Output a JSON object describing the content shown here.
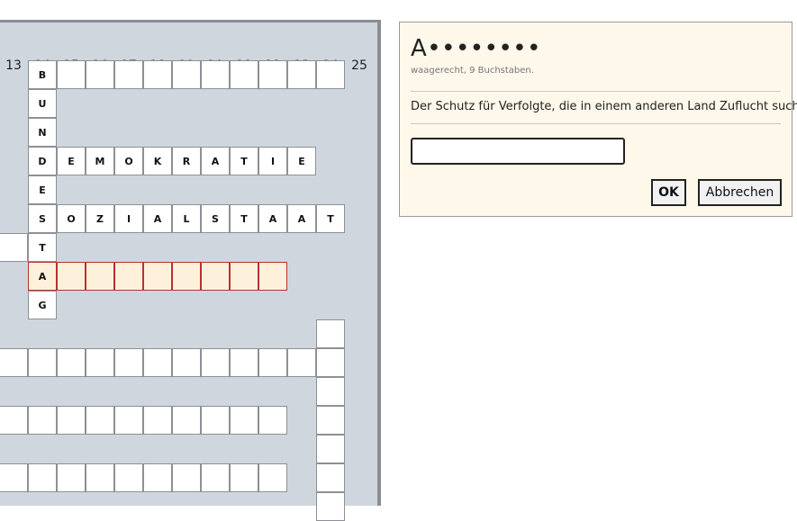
{
  "board": {
    "column_numbers": [
      "13",
      "14",
      "15",
      "16",
      "17",
      "18",
      "19",
      "20",
      "21",
      "22",
      "23",
      "24",
      "25"
    ],
    "entries": [
      {
        "col": 14,
        "row": 1,
        "dir": "down",
        "answer": "BUNDESTAG"
      },
      {
        "col": 14,
        "row": 1,
        "dir": "across",
        "answer": "B          "
      },
      {
        "col": 14,
        "row": 4,
        "dir": "across",
        "answer": "DEMOKRATIE"
      },
      {
        "col": 14,
        "row": 6,
        "dir": "across",
        "answer": "SOZIALSTAAT"
      },
      {
        "col": 14,
        "row": 8,
        "dir": "across",
        "answer": "A        ",
        "highlighted": true
      },
      {
        "col": 24,
        "row": 10,
        "dir": "down",
        "answer": "       "
      },
      {
        "col": 13,
        "row": 11,
        "dir": "across",
        "answer": "            "
      },
      {
        "col": 13,
        "row": 13,
        "dir": "across",
        "answer": "          "
      },
      {
        "col": 13,
        "row": 15,
        "dir": "across",
        "answer": "          "
      },
      {
        "col": 13,
        "row": 7,
        "dir": "across",
        "answer": " "
      }
    ]
  },
  "clue": {
    "pattern": "A••••••••",
    "meta": "waagerecht, 9 Buchstaben.",
    "text": "Der Schutz für Verfolgte, die in einem anderen Land Zuflucht suchen.",
    "answer_value": "",
    "ok_label": "OK",
    "cancel_label": "Abbrechen"
  }
}
